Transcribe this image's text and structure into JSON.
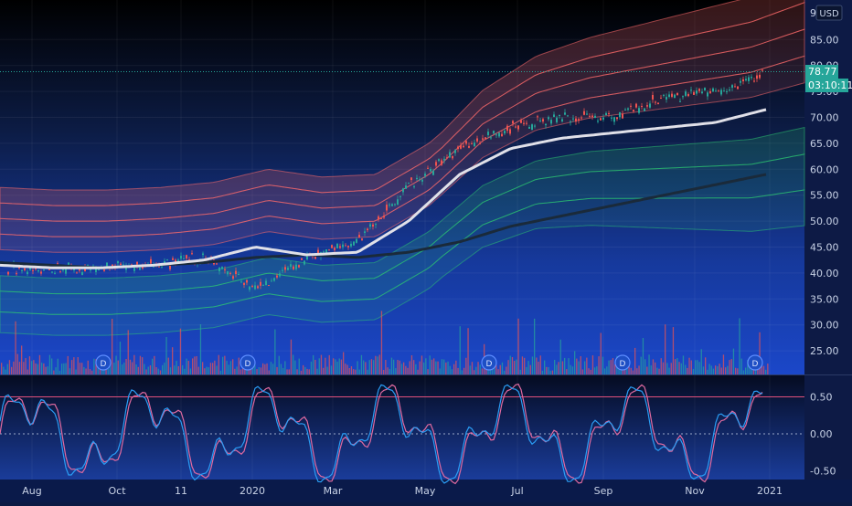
{
  "currency": {
    "label": "USD"
  },
  "last_price": {
    "value": "78.77",
    "countdown": "03:10:11",
    "badge_color": "#26a69a"
  },
  "main_axis": {
    "ticks": [
      "9",
      "85.00",
      "80.00",
      "75.00",
      "70.00",
      "65.00",
      "60.00",
      "55.00",
      "50.00",
      "45.00",
      "40.00",
      "35.00",
      "30.00",
      "25.00"
    ]
  },
  "osc_axis": {
    "ticks": [
      "0.50",
      "0.00",
      "-0.50"
    ]
  },
  "time_axis": {
    "ticks": [
      "Aug",
      "Oct",
      "11",
      "2020",
      "Mar",
      "May",
      "Jul",
      "Sep",
      "Nov",
      "2021"
    ]
  },
  "dividend_marker": {
    "label": "D"
  },
  "colors": {
    "upper_band": "#ff6b6b",
    "lower_band": "#2ecc71",
    "ma_fast": "#e0e0e8",
    "ma_slow": "#1a2a3a",
    "osc_line_a": "#e06aa0",
    "osc_line_b": "#2a9df4",
    "hline_red": "#e0507a"
  },
  "chart_data": {
    "type": "line",
    "title": "",
    "ylim": [
      22,
      90
    ],
    "x": [
      "Aug",
      "Oct",
      "11",
      "2020",
      "Mar",
      "May",
      "Jul",
      "Sep",
      "Nov",
      "2021"
    ],
    "series": [
      {
        "values": [
          41,
          40.5,
          41,
          41.5,
          43,
          37,
          43,
          46,
          57,
          64,
          68,
          70,
          70,
          74,
          75,
          78.77
        ]
      },
      {
        "values": [
          41.5,
          41,
          41,
          41.5,
          42.5,
          45,
          43.5,
          44,
          50,
          59,
          64,
          66,
          67,
          68,
          69,
          71.5
        ]
      },
      {
        "values": [
          42,
          41.5,
          41,
          41.5,
          42,
          43,
          43.5,
          43,
          44,
          46,
          49,
          51,
          53,
          55,
          57,
          59
        ]
      }
    ],
    "osc_ylim": [
      -0.6,
      0.8
    ],
    "osc_hline": 0.5
  }
}
